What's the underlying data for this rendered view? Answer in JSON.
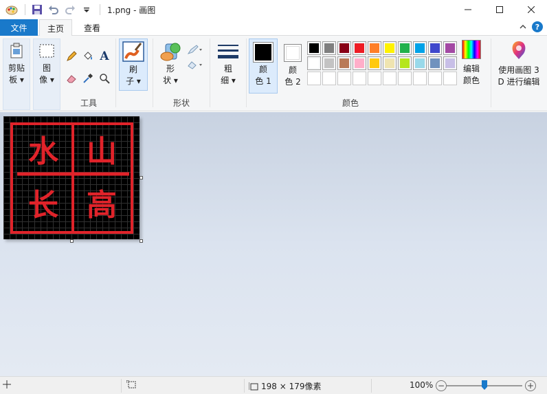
{
  "titlebar": {
    "title": "1.png - 画图"
  },
  "tabs": {
    "file": "文件",
    "home": "主页",
    "view": "查看"
  },
  "ribbon": {
    "clipboard": {
      "line1": "剪贴",
      "line2": "板 ▾"
    },
    "image": {
      "line1": "图",
      "line2": "像 ▾"
    },
    "tools_label": "工具",
    "brush": {
      "line1": "刷",
      "line2": "子 ▾"
    },
    "shapes": {
      "line1": "形",
      "line2": "状 ▾",
      "group_label": "形状"
    },
    "size": {
      "line1": "粗",
      "line2": "细 ▾"
    },
    "color1": {
      "line1": "颜",
      "line2": "色 1",
      "value": "#000000"
    },
    "color2": {
      "line1": "颜",
      "line2": "色 2",
      "value": "#ffffff"
    },
    "colors_label": "颜色",
    "edit_colors": {
      "line1": "编辑",
      "line2": "颜色"
    },
    "paint3d": {
      "line1": "使用画图 3",
      "line2": "D 进行编辑"
    },
    "palette_row1": [
      "#000000",
      "#7f7f7f",
      "#880015",
      "#ed1c24",
      "#ff7f27",
      "#fff200",
      "#22b14c",
      "#00a2e8",
      "#3f48cc",
      "#a349a4"
    ],
    "palette_row2": [
      "#ffffff",
      "#c3c3c3",
      "#b97a57",
      "#ffaec9",
      "#ffc90e",
      "#efe4b0",
      "#b5e61d",
      "#99d9ea",
      "#7092be",
      "#c8bfe7"
    ],
    "palette_row3": [
      "#ffffff",
      "#ffffff",
      "#ffffff",
      "#ffffff",
      "#ffffff",
      "#ffffff",
      "#ffffff",
      "#ffffff",
      "#ffffff",
      "#ffffff"
    ]
  },
  "canvas": {
    "chars": [
      "水",
      "山",
      "长",
      "高"
    ],
    "accent": "#e0232a"
  },
  "statusbar": {
    "size": "198 × 179像素",
    "zoom": "100%",
    "zoom_value_percent": 100
  }
}
